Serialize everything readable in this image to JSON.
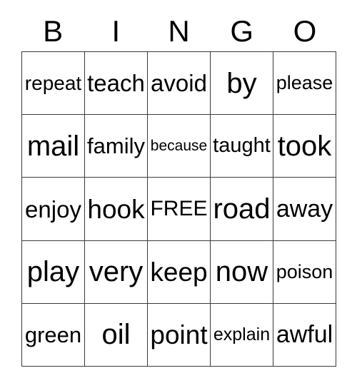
{
  "card": {
    "title_letters": [
      "B",
      "I",
      "N",
      "G",
      "O"
    ],
    "columns": 5,
    "rows": 5,
    "free_space_label": "FREE",
    "text_color": "#000000",
    "background_color": "#ffffff",
    "border_color": "#3a3a3a"
  },
  "grid": {
    "rows": [
      {
        "cells": [
          {
            "word": "repeat"
          },
          {
            "word": "teach"
          },
          {
            "word": "avoid"
          },
          {
            "word": "by"
          },
          {
            "word": "please"
          }
        ]
      },
      {
        "cells": [
          {
            "word": "mail"
          },
          {
            "word": "family"
          },
          {
            "word": "because"
          },
          {
            "word": "taught"
          },
          {
            "word": "took"
          }
        ]
      },
      {
        "cells": [
          {
            "word": "enjoy"
          },
          {
            "word": "hook"
          },
          {
            "word": "FREE"
          },
          {
            "word": "road"
          },
          {
            "word": "away"
          }
        ]
      },
      {
        "cells": [
          {
            "word": "play"
          },
          {
            "word": "very"
          },
          {
            "word": "keep"
          },
          {
            "word": "now"
          },
          {
            "word": "poison"
          }
        ]
      },
      {
        "cells": [
          {
            "word": "green"
          },
          {
            "word": "oil"
          },
          {
            "word": "point"
          },
          {
            "word": "explain"
          },
          {
            "word": "awful"
          }
        ]
      }
    ]
  }
}
